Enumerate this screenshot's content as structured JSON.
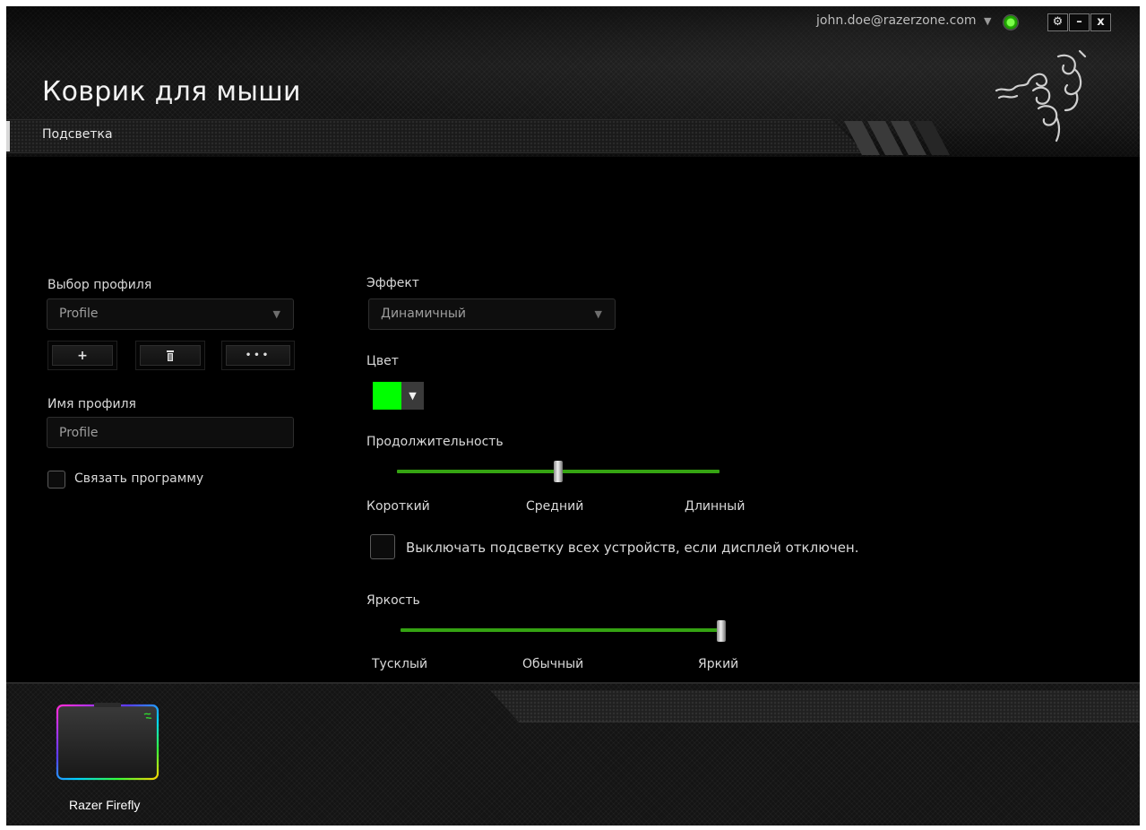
{
  "header": {
    "user_email": "john.doe@razerzone.com",
    "page_title": "Коврик для мыши",
    "active_tab": "Подсветка",
    "window_buttons": {
      "settings": "⚙",
      "minimize": "–",
      "close": "x"
    }
  },
  "profile": {
    "select_label": "Выбор профиля",
    "selected_profile": "Profile",
    "add_label": "+",
    "delete_label": "🗑",
    "more_label": "•••",
    "name_label": "Имя профиля",
    "name_value": "Profile",
    "link_program_label": "Связать программу"
  },
  "lighting": {
    "effect_label": "Эффект",
    "effect_value": "Динамичный",
    "color_label": "Цвет",
    "color_value": "#00ff00",
    "duration": {
      "label": "Продолжительность",
      "level": 0.5,
      "short": "Короткий",
      "medium": "Средний",
      "long": "Длинный"
    },
    "display_off_label": "Выключать подсветку всех устройств, если дисплей отключен.",
    "brightness": {
      "label": "Яркость",
      "level": 1.0,
      "dim": "Тусклый",
      "normal": "Обычный",
      "bright": "Яркий"
    }
  },
  "footer": {
    "device_name": "Razer Firefly"
  },
  "colors": {
    "accent_green": "#35a312",
    "background": "#000000"
  }
}
